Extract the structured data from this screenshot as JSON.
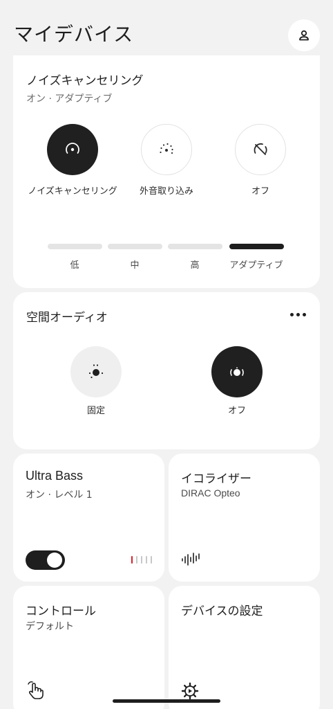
{
  "header": {
    "title": "マイデバイス",
    "profile_icon": "person-icon"
  },
  "noise_cancelling": {
    "title": "ノイズキャンセリング",
    "status": "オン · アダプティブ",
    "modes": [
      {
        "label": "ノイズキャンセリング",
        "icon": "noise-cancel-icon",
        "active": true
      },
      {
        "label": "外音取り込み",
        "icon": "ambient-sound-icon",
        "active": false
      },
      {
        "label": "オフ",
        "icon": "anc-off-icon",
        "active": false
      }
    ],
    "levels": [
      {
        "label": "低",
        "active": false
      },
      {
        "label": "中",
        "active": false
      },
      {
        "label": "高",
        "active": false
      },
      {
        "label": "アダプティブ",
        "active": true
      }
    ]
  },
  "spatial_audio": {
    "title": "空間オーディオ",
    "options": [
      {
        "label": "固定",
        "icon": "spatial-fixed-icon",
        "active": false
      },
      {
        "label": "オフ",
        "icon": "spatial-off-icon",
        "active": true
      }
    ]
  },
  "ultra_bass": {
    "title": "Ultra Bass",
    "status": "オン · レベル 1",
    "enabled": true,
    "level": 1,
    "level_max": 5,
    "accent_color": "#d81e2a"
  },
  "equalizer": {
    "title": "イコライザー",
    "status": "DIRAC Opteo",
    "icon": "equalizer-icon"
  },
  "controls": {
    "title": "コントロール",
    "status": "デフォルト",
    "icon": "touch-gesture-icon"
  },
  "device_settings": {
    "title": "デバイスの設定",
    "icon": "gear-icon"
  }
}
